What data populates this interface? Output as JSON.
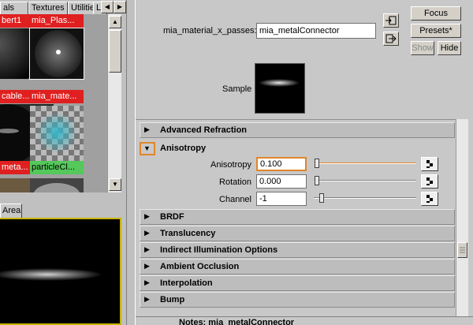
{
  "left_pane": {
    "tabs": [
      {
        "label": "als"
      },
      {
        "label": "Textures"
      },
      {
        "label": "Utilities"
      },
      {
        "label": "L"
      }
    ],
    "swatches": [
      {
        "label": "bert1",
        "state": "red"
      },
      {
        "label": "mia_Plas...",
        "state": "red"
      },
      {
        "label": "cable...",
        "state": "red"
      },
      {
        "label": "mia_mate...",
        "state": "red"
      },
      {
        "label": "meta...",
        "state": "red"
      },
      {
        "label": "particleCl...",
        "state": "green"
      }
    ],
    "area_tab": "Area"
  },
  "header": {
    "node_type_label": "mia_material_x_passes:",
    "node_name_value": "mia_metalConnector",
    "focus_button": "Focus",
    "presets_button": "Presets*",
    "show_button": "Show",
    "hide_button": "Hide",
    "sample_label": "Sample"
  },
  "sections": {
    "advanced_refraction": "Advanced Refraction",
    "anisotropy": "Anisotropy",
    "brdf": "BRDF",
    "translucency": "Translucency",
    "indirect_illumination": "Indirect Illumination Options",
    "ambient_occlusion": "Ambient Occlusion",
    "interpolation": "Interpolation",
    "bump": "Bump"
  },
  "anisotropy_attrs": {
    "anisotropy_label": "Anisotropy",
    "anisotropy_value": "0.100",
    "rotation_label": "Rotation",
    "rotation_value": "0.000",
    "channel_label": "Channel",
    "channel_value": "-1"
  },
  "bottom_bar": {
    "text": "Notes: mia_metalConnector"
  },
  "colors": {
    "accent_orange": "#e0862a",
    "swatch_red": "#e02020",
    "swatch_green": "#54c85a"
  }
}
